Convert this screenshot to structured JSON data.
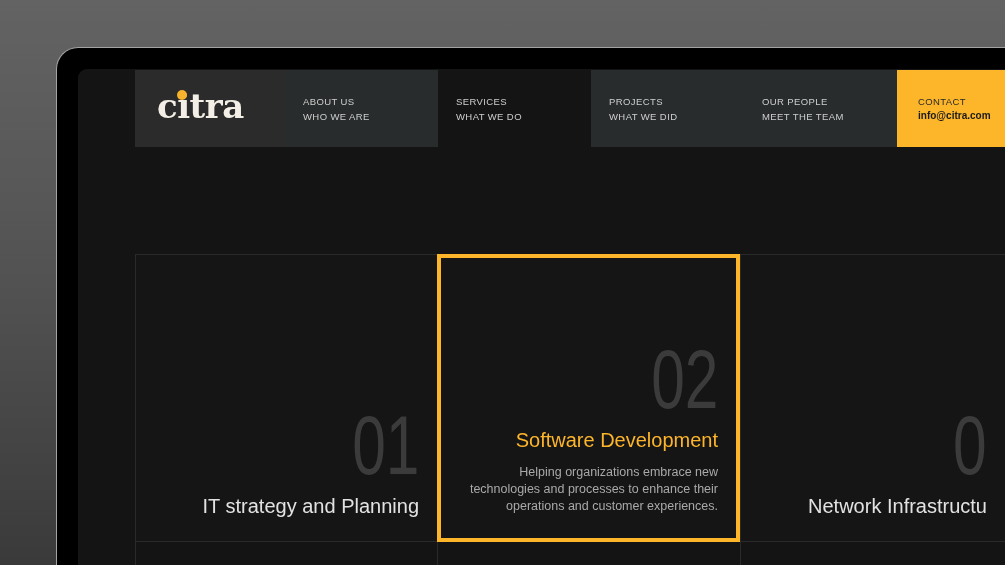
{
  "logo": {
    "text": "citra"
  },
  "nav": [
    {
      "label": "ABOUT US",
      "sublabel": "WHO WE ARE",
      "selected": false
    },
    {
      "label": "SERVICES",
      "sublabel": "WHAT WE DO",
      "selected": true
    },
    {
      "label": "PROJECTS",
      "sublabel": "WHAT WE DID",
      "selected": false
    },
    {
      "label": "OUR PEOPLE",
      "sublabel": "MEET THE TEAM",
      "selected": false
    }
  ],
  "contact": {
    "label": "CONTACT",
    "email": "info@citra.com"
  },
  "services": [
    {
      "number": "01",
      "title": "IT strategy and Planning",
      "selected": false
    },
    {
      "number": "02",
      "title": "Software Development",
      "description": "Helping organizations embrace new technologies and processes to enhance their operations and customer experiences.",
      "selected": true
    },
    {
      "number": "0",
      "title": "Network Infrastructu",
      "selected": false
    }
  ]
}
